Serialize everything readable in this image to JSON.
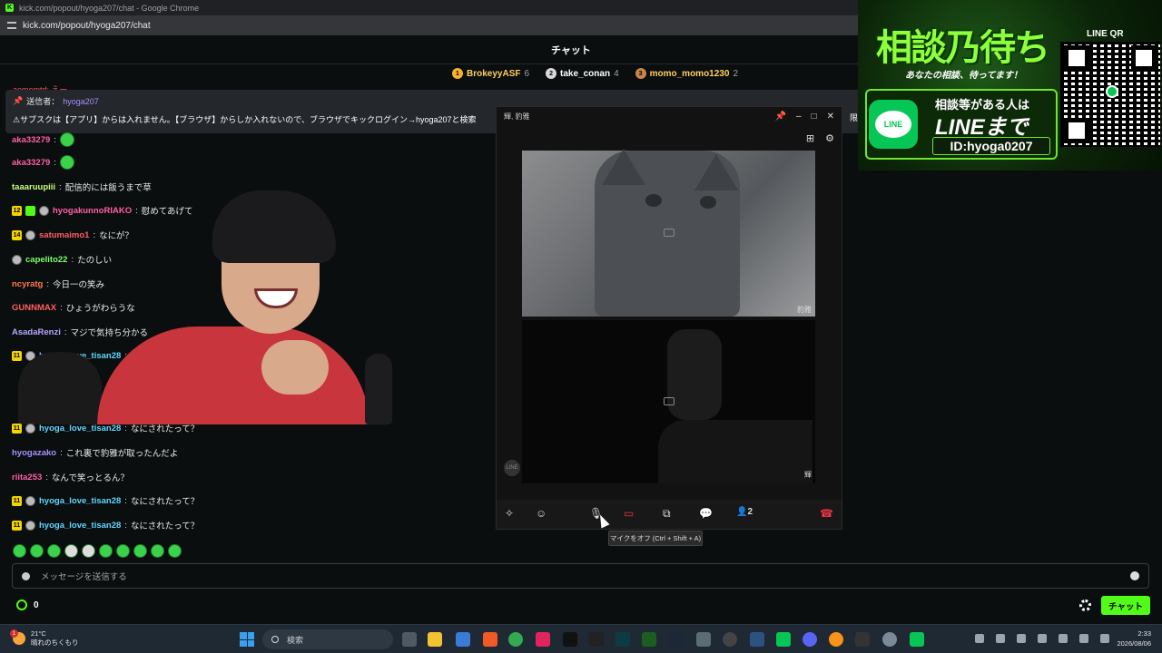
{
  "browser": {
    "window_title": "kick.com/popout/hyoga207/chat - Google Chrome",
    "url": "kick.com/popout/hyoga207/chat"
  },
  "chat": {
    "title": "チャット",
    "leaders": [
      {
        "rank": "1",
        "name": "BrokeyyASF",
        "count": "6",
        "color": "#f5b32a"
      },
      {
        "rank": "2",
        "name": "take_conan",
        "count": "4",
        "color": "#d8d8d8"
      },
      {
        "rank": "3",
        "name": "momo_momo1230",
        "count": "2",
        "color": "#c8864a"
      }
    ],
    "cut_line": "aomomtd: えー",
    "pinned": {
      "label": "送信者：",
      "sender": "hyoga207",
      "text": "⚠サブスクは【アプリ】からは入れません。【ブラウザ】からしか入れないので、ブラウザでキックログイン→hyoga207と検索",
      "suffix": "限定"
    },
    "messages": [
      {
        "user": "aka33279",
        "text": "",
        "color": "#ff5fa8"
      },
      {
        "user": "aka33279",
        "text": "",
        "color": "#ff5fa8"
      },
      {
        "user": "taaaruupiii",
        "text": "配信的には飯うまで草",
        "color": "#c7ff7a"
      },
      {
        "badge": "12",
        "user": "hyogakunnoRIAKO",
        "text": "慰めてあげて",
        "color": "#ff5fa8"
      },
      {
        "badge": "14",
        "user": "satumaimo1",
        "text": "なにが？",
        "color": "#ff5f5f"
      },
      {
        "user": "capelito22",
        "text": "たのしい",
        "color": "#7cff6b"
      },
      {
        "user": "ncyratg",
        "text": "今日一の笑み",
        "color": "#ff7a4a"
      },
      {
        "user": "GUNNMAX",
        "text": "ひょうがわらうな",
        "color": "#ff5f5f"
      },
      {
        "user": "AsadaRenzi",
        "text": "マジで気持ち分かる",
        "color": "#b7a8ff"
      },
      {
        "badge": "11",
        "user": "hyoga_love_tisan28",
        "text": "なにされたって？",
        "color": "#5fd8ff"
      },
      {
        "user": "hyogazako",
        "text": "これ裏で豹雅が取ったんだよ",
        "color": "#a98fff"
      },
      {
        "user": "riita253",
        "text": "なんで笑っとるん？",
        "color": "#ff5fa8"
      },
      {
        "badge": "11",
        "user": "hyoga_love_tisan28",
        "text": "なにされたって？",
        "color": "#5fd8ff"
      },
      {
        "badge": "11",
        "user": "hyoga_love_tisan28",
        "text": "なにされたって？",
        "color": "#5fd8ff"
      }
    ],
    "partial_msg": {
      "badge": "11",
      "user": "hyoga_love_tisan28",
      "text": "な"
    },
    "input_placeholder": "メッセージを送信する",
    "points": "0",
    "send_label": "チャット"
  },
  "call": {
    "title": "輝, 豹雅",
    "video1_label": "豹雅",
    "video2_label": "輝",
    "participants": "2",
    "tooltip": "マイクをオフ (Ctrl + Shift + A)",
    "line_mark": "LINE"
  },
  "ad": {
    "title": "相談乃待ち",
    "subtitle": "あなたの相談、待ってます！",
    "line_text1": "相談等がある人は",
    "line_text2": "LINEまで",
    "line_id": "ID:hyoga0207",
    "qr_label": "LINE QR",
    "line_icon": "LINE"
  },
  "taskbar": {
    "temperature": "21°C",
    "weather": "晴れのちくもり",
    "search_placeholder": "検索",
    "time": "2:33",
    "date": "2026/08/06",
    "notification_count": "1"
  }
}
